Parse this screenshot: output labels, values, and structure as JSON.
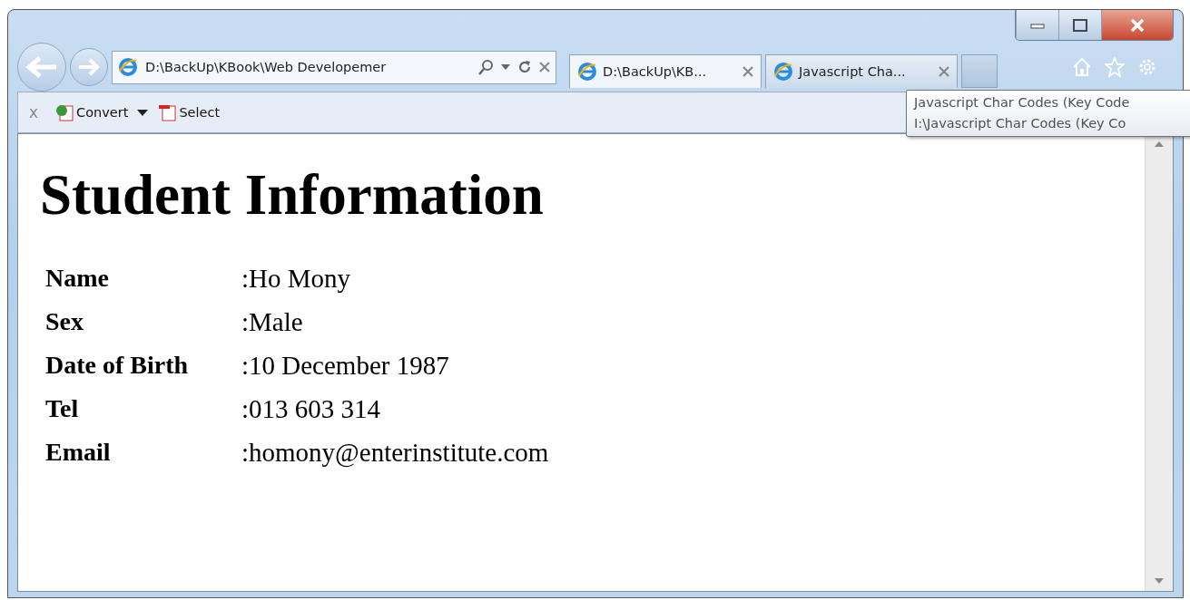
{
  "address": {
    "value": "D:\\BackUp\\KBook\\Web Developemer"
  },
  "tabs": [
    {
      "label": "D:\\BackUp\\KB...",
      "selected": true
    },
    {
      "label": "Javascript Cha...",
      "selected": false
    }
  ],
  "toolbar": {
    "close": "x",
    "items": [
      "Convert",
      "Select"
    ]
  },
  "tooltip": {
    "lines": [
      "Javascript Char Codes (Key Code",
      "I:\\Javascript Char Codes (Key Co"
    ]
  },
  "page": {
    "heading": "Student Information",
    "rows": [
      {
        "label": "Name",
        "value": ":Ho Mony"
      },
      {
        "label": "Sex",
        "value": ":Male"
      },
      {
        "label": "Date of Birth",
        "value": ":10 December 1987"
      },
      {
        "label": "Tel",
        "value": ":013 603 314"
      },
      {
        "label": "Email",
        "value": ":homony@enterinstitute.com"
      }
    ]
  }
}
